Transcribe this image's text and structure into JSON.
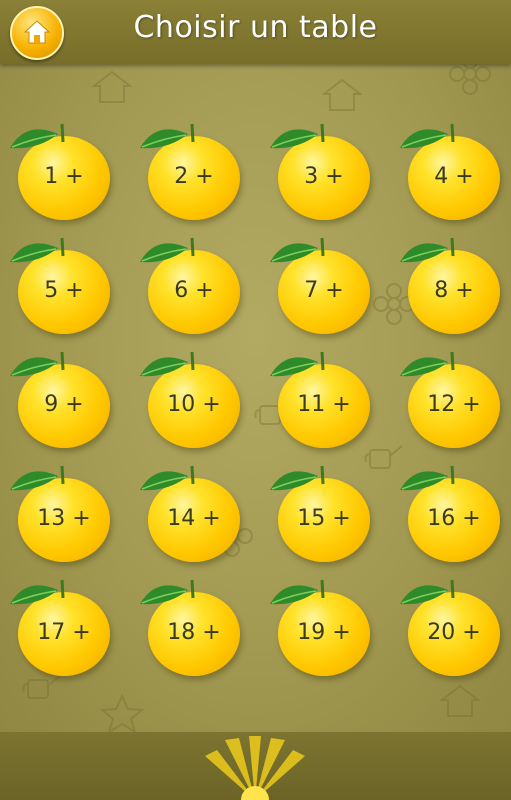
{
  "header": {
    "title": "Choisir un table",
    "home_icon": "home-icon"
  },
  "tables": [
    {
      "label": "1 +"
    },
    {
      "label": "2 +"
    },
    {
      "label": "3 +"
    },
    {
      "label": "4 +"
    },
    {
      "label": "5 +"
    },
    {
      "label": "6 +"
    },
    {
      "label": "7 +"
    },
    {
      "label": "8 +"
    },
    {
      "label": "9 +"
    },
    {
      "label": "10 +"
    },
    {
      "label": "11 +"
    },
    {
      "label": "12 +"
    },
    {
      "label": "13 +"
    },
    {
      "label": "14 +"
    },
    {
      "label": "15 +"
    },
    {
      "label": "16 +"
    },
    {
      "label": "17 +"
    },
    {
      "label": "18 +"
    },
    {
      "label": "19 +"
    },
    {
      "label": "20 +"
    }
  ],
  "colors": {
    "header_bg": "#7f7630",
    "board_bg": "#a29a52",
    "fruit": "#ffc800",
    "leaf": "#2f8a2a"
  }
}
